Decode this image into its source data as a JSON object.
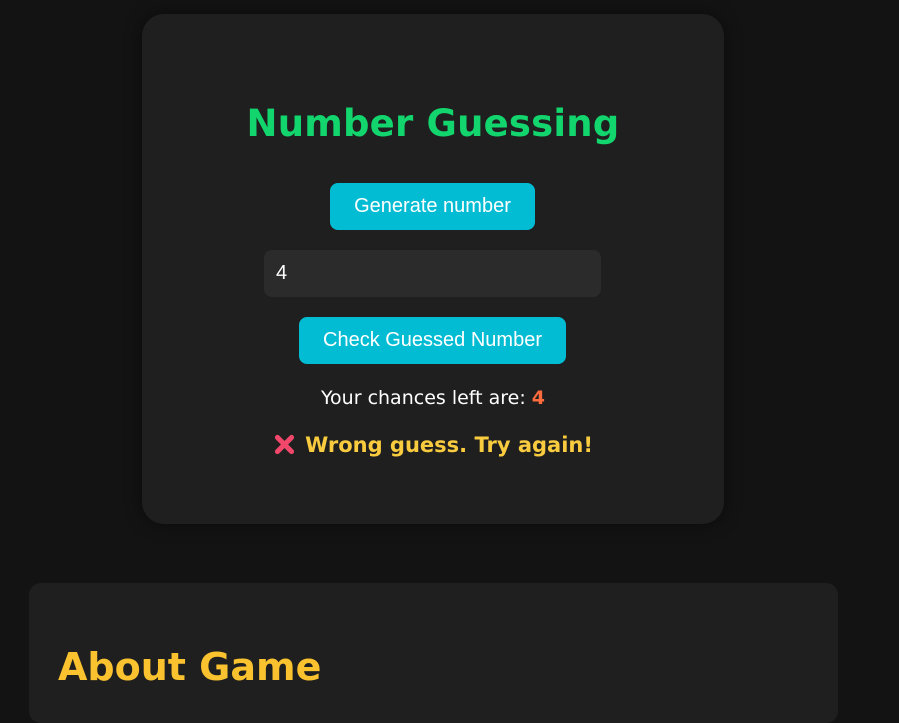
{
  "game": {
    "title": "Number Guessing",
    "generate_label": "Generate number",
    "guess_value": "4",
    "check_label": "Check Guessed Number",
    "chances_label": "Your chances left are: ",
    "chances_left": "4",
    "result_message": "Wrong guess. Try again!",
    "result_icon": "cross-mark-icon"
  },
  "about": {
    "heading": "About Game"
  },
  "colors": {
    "background": "#131313",
    "card": "#1f1f1f",
    "title_green": "#12d56d",
    "button_cyan": "#02bcd4",
    "chances_orange": "#ff6b3d",
    "message_yellow": "#f9cb3e",
    "cross_red": "#f0476b",
    "about_yellow": "#f9c22e"
  }
}
